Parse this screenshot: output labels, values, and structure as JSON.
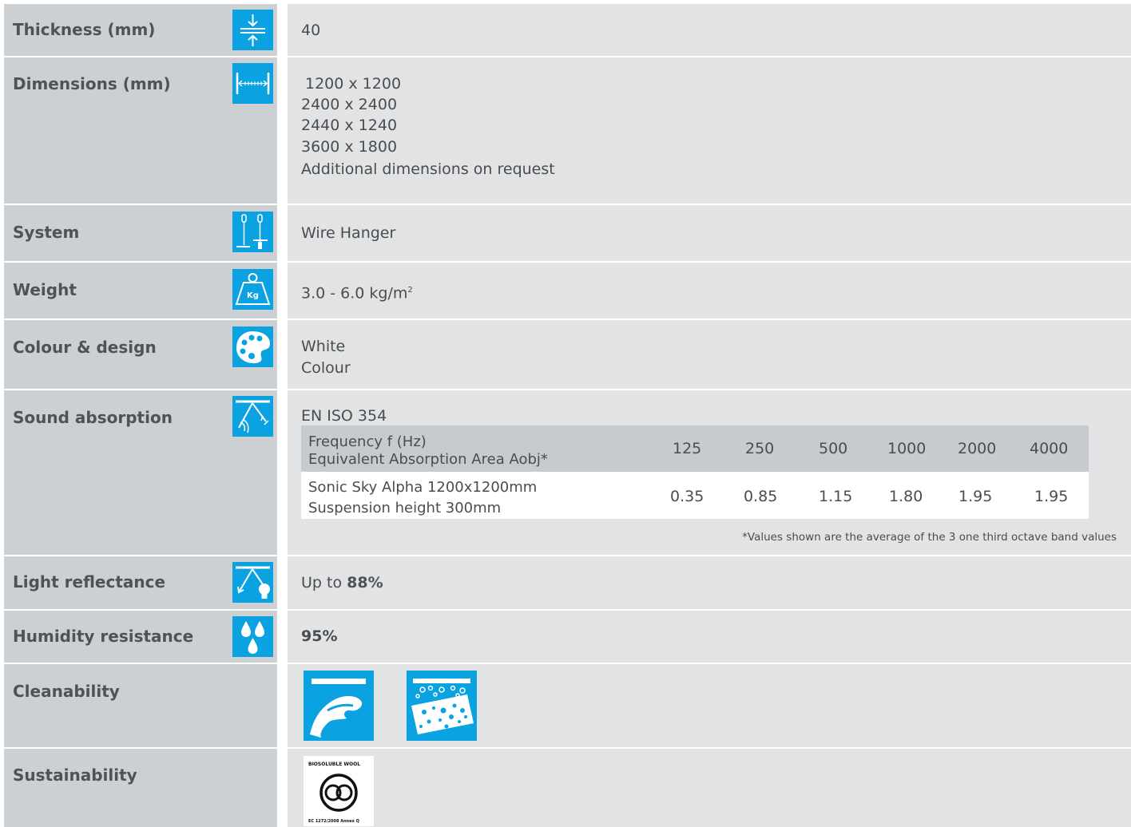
{
  "rows": {
    "thickness": {
      "label": "Thickness (mm)",
      "value": "40",
      "icon": "thickness-icon"
    },
    "dimensions": {
      "label": "Dimensions (mm)",
      "icon": "dimensions-icon",
      "lines": [
        "1200 x 1200",
        "2400 x 2400",
        "2440 x 1240",
        "3600 x 1800",
        "Additional dimensions on request"
      ]
    },
    "system": {
      "label": "System",
      "value": "Wire Hanger",
      "icon": "wire-hanger-icon"
    },
    "weight": {
      "label": "Weight",
      "value": "3.0 - 6.0 kg/m",
      "unit_sup": "2",
      "icon": "weight-icon",
      "icon_text": "Kg"
    },
    "colour": {
      "label": "Colour & design",
      "lines": [
        "White",
        "Colour"
      ],
      "icon": "palette-icon"
    },
    "sound": {
      "label": "Sound absorption",
      "icon": "sound-absorption-icon",
      "standard": "EN ISO 354",
      "header_lines": [
        "Frequency f (Hz)",
        "Equivalent Absorption Area Aobj*"
      ],
      "frequencies": [
        "125",
        "250",
        "500",
        "1000",
        "2000",
        "4000"
      ],
      "row_lines": [
        "Sonic Sky Alpha 1200x1200mm",
        "Suspension height 300mm"
      ],
      "values": [
        "0.35",
        "0.85",
        "1.15",
        "1.80",
        "1.95",
        "1.95"
      ],
      "note": "*Values shown are the average of the 3 one third octave band values"
    },
    "light": {
      "label": "Light reflectance",
      "prefix": "Up to",
      "value": "88%",
      "icon": "light-reflectance-icon"
    },
    "humidity": {
      "label": "Humidity resistance",
      "value": "95%",
      "icon": "humidity-icon"
    },
    "clean": {
      "label": "Cleanability",
      "icons": [
        "wipe-clean-icon",
        "sponge-clean-icon"
      ]
    },
    "sustain": {
      "label": "Sustainability",
      "badge_top": "BIOSOLUBLE WOOL",
      "badge_bottom": "EC 1272/2008 Annex Q"
    }
  },
  "colors": {
    "label_bg": "#cdd0d2",
    "value_bg": "#e1e3e4",
    "icon_blue": "#0aa2e0"
  }
}
